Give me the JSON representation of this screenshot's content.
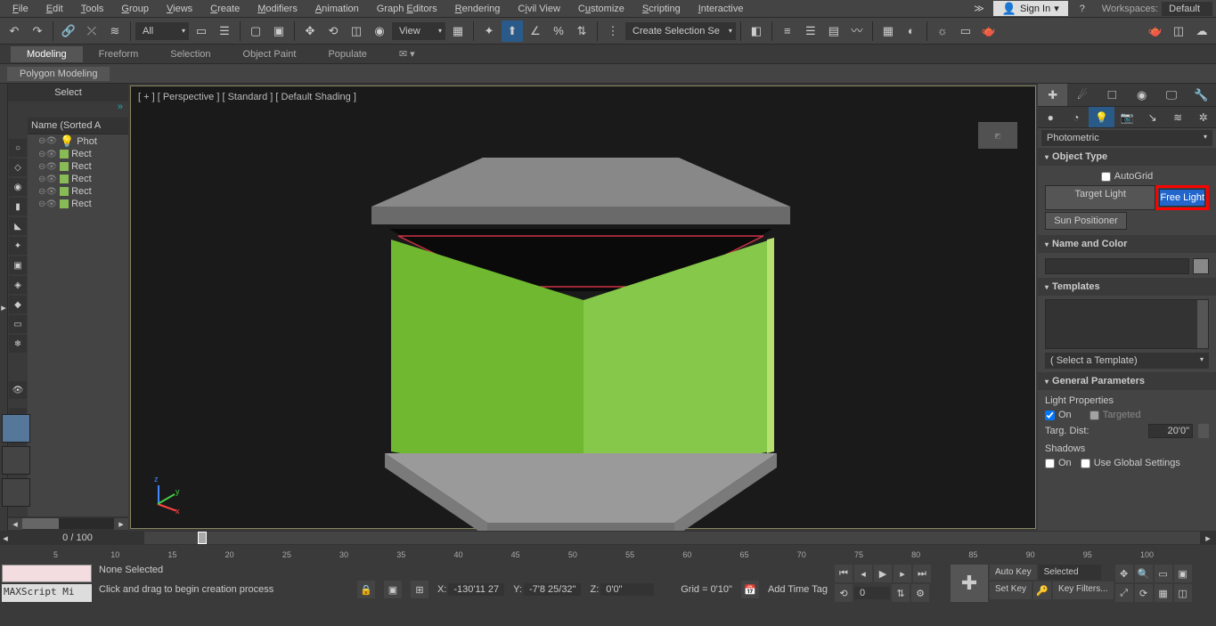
{
  "menu": {
    "items": [
      "File",
      "Edit",
      "Tools",
      "Group",
      "Views",
      "Create",
      "Modifiers",
      "Animation",
      "Graph Editors",
      "Rendering",
      "Civil View",
      "Customize",
      "Scripting",
      "Interactive"
    ],
    "signin": "Sign In",
    "ws_label": "Workspaces:",
    "ws_value": "Default"
  },
  "toolbar": {
    "filter": "All",
    "view": "View",
    "selset": "Create Selection Se"
  },
  "ribbon": {
    "tabs": [
      "Modeling",
      "Freeform",
      "Selection",
      "Object Paint",
      "Populate"
    ],
    "sub": "Polygon Modeling"
  },
  "scene": {
    "title": "Select",
    "header": "Name (Sorted A",
    "items": [
      {
        "name": "Phot",
        "sw": "swatch-r"
      },
      {
        "name": "Rect",
        "sw": "swatch-g"
      },
      {
        "name": "Rect",
        "sw": "swatch-g"
      },
      {
        "name": "Rect",
        "sw": "swatch-g"
      },
      {
        "name": "Rect",
        "sw": "swatch-g"
      },
      {
        "name": "Rect",
        "sw": "swatch-g"
      }
    ]
  },
  "viewport": {
    "label": "[ + ] [ Perspective ] [ Standard ] [ Default Shading ]"
  },
  "cp": {
    "category": "Photometric",
    "rollouts": {
      "objtype": {
        "title": "Object Type",
        "autogrid": "AutoGrid",
        "target": "Target Light",
        "free": "Free Light",
        "sun": "Sun Positioner"
      },
      "namecolor": {
        "title": "Name and Color"
      },
      "templates": {
        "title": "Templates",
        "select": "( Select a Template)"
      },
      "genparams": {
        "title": "General Parameters",
        "lp": "Light Properties",
        "on": "On",
        "targeted": "Targeted",
        "td": "Targ. Dist:",
        "tdv": "20'0\"",
        "shadows": "Shadows",
        "ugs": "Use Global Settings"
      }
    }
  },
  "timeline": {
    "pos": "0 / 100",
    "ticks": [
      5,
      10,
      15,
      20,
      25,
      30,
      35,
      40,
      45,
      50,
      55,
      60,
      65,
      70,
      75,
      80,
      85,
      90,
      95,
      100
    ]
  },
  "status": {
    "sel": "None Selected",
    "hint": "Click and drag to begin creation process",
    "x": "-130'11 27",
    "y": "-7'8 25/32\"",
    "z": "0'0\"",
    "grid": "Grid = 0'10\"",
    "script": "MAXScript Mi",
    "auto": "Auto Key",
    "set": "Set Key",
    "seldd": "Selected",
    "kf": "Key Filters...",
    "addtag": "Add Time Tag",
    "frame": "0"
  }
}
